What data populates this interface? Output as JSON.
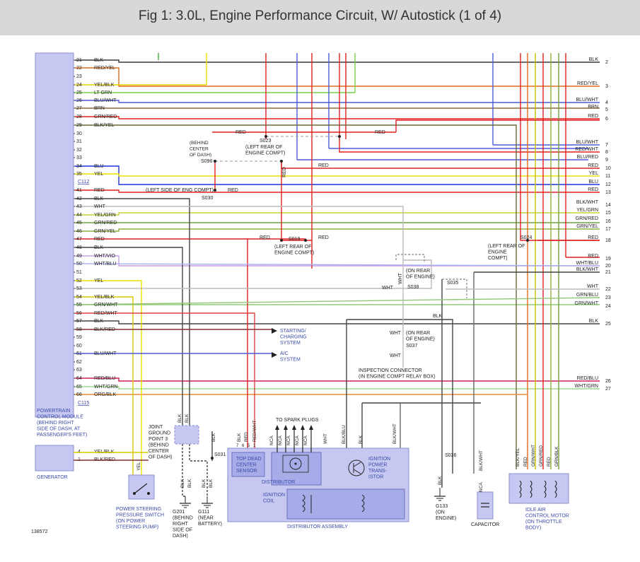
{
  "title": "Fig 1: 3.0L, Engine Performance Circuit, W/ Autostick (1 of 4)",
  "figure_number": "138572",
  "pcm": {
    "label_lines": [
      "POWERTRAIN",
      "CONTROL MODULE",
      "(BEHIND RIGHT",
      "SIDE OF DASH, AT",
      "PASSENGER'S FEET)"
    ],
    "connector_c112": "C112",
    "connector_c115": "C115"
  },
  "pins": [
    {
      "pin": "21",
      "wire": "BLK",
      "color": "#3a3a3a",
      "end": "2"
    },
    {
      "pin": "22",
      "wire": "RED/YEL",
      "color": "#e06a1a",
      "end": "3"
    },
    {
      "pin": "23",
      "wire": "",
      "color": "#e06a1a",
      "end": ""
    },
    {
      "pin": "24",
      "wire": "YEL/BLK",
      "color": "#e3d000",
      "end": ""
    },
    {
      "pin": "25",
      "wire": "LT GRN",
      "color": "#7ad14a",
      "end": ""
    },
    {
      "pin": "26",
      "wire": "BLU/WHT",
      "color": "#4c5ad8",
      "end": "4"
    },
    {
      "pin": "27",
      "wire": "BRN",
      "color": "#8b6a3e",
      "end": "5"
    },
    {
      "pin": "28",
      "wire": "GRN/RED",
      "color": "#7aa03a",
      "end": "6"
    },
    {
      "pin": "29",
      "wire": "BLK/YEL",
      "color": "#6e6a3a",
      "end": ""
    },
    {
      "pin": "30",
      "wire": "",
      "color": "#9a9a9a",
      "end": ""
    },
    {
      "pin": "31",
      "wire": "",
      "color": "#9a9a9a",
      "end": ""
    },
    {
      "pin": "32",
      "wire": "",
      "color": "#9a9a9a",
      "end": ""
    },
    {
      "pin": "33",
      "wire": "",
      "color": "#9a9a9a",
      "end": ""
    },
    {
      "pin": "34",
      "wire": "BLU",
      "color": "#2030e0",
      "end": "12"
    },
    {
      "pin": "35",
      "wire": "YEL",
      "color": "#e8e000",
      "end": "11"
    },
    {
      "pin": "41",
      "wire": "RED",
      "color": "#e02020",
      "end": "13"
    },
    {
      "pin": "42",
      "wire": "BLK",
      "color": "#444444",
      "end": ""
    },
    {
      "pin": "43",
      "wire": "WHT",
      "color": "#bbbbbb",
      "end": ""
    },
    {
      "pin": "44",
      "wire": "YEL/GRN",
      "color": "#c8d030",
      "end": "15"
    },
    {
      "pin": "45",
      "wire": "GRN/RED",
      "color": "#70a040",
      "end": "16"
    },
    {
      "pin": "46",
      "wire": "GRN/YEL",
      "color": "#90b040",
      "end": "17"
    },
    {
      "pin": "47",
      "wire": "RED",
      "color": "#e02020",
      "end": "18"
    },
    {
      "pin": "48",
      "wire": "BLK",
      "color": "#444444",
      "end": ""
    },
    {
      "pin": "49",
      "wire": "WHT/VIO",
      "color": "#c8a0e8",
      "end": "20"
    },
    {
      "pin": "50",
      "wire": "WHT/BLU",
      "color": "#a8b0f0",
      "end": ""
    },
    {
      "pin": "51",
      "wire": "",
      "color": "#9a9a9a",
      "end": ""
    },
    {
      "pin": "52",
      "wire": "YEL",
      "color": "#e8e000",
      "end": ""
    },
    {
      "pin": "53",
      "wire": "",
      "color": "#9a9a9a",
      "end": ""
    },
    {
      "pin": "54",
      "wire": "YEL/BLK",
      "color": "#d8c800",
      "end": ""
    },
    {
      "pin": "55",
      "wire": "GRN/WHT",
      "color": "#90c878",
      "end": "24"
    },
    {
      "pin": "56",
      "wire": "RED/WHT",
      "color": "#e04040",
      "end": ""
    },
    {
      "pin": "57",
      "wire": "BLK",
      "color": "#444444",
      "end": "25"
    },
    {
      "pin": "58",
      "wire": "BLK/RED",
      "color": "#883030",
      "end": ""
    },
    {
      "pin": "59",
      "wire": "",
      "color": "#9a9a9a",
      "end": ""
    },
    {
      "pin": "60",
      "wire": "",
      "color": "#9a9a9a",
      "end": ""
    },
    {
      "pin": "61",
      "wire": "BLU/WHT",
      "color": "#4c5ad8",
      "end": ""
    },
    {
      "pin": "62",
      "wire": "",
      "color": "#9a9a9a",
      "end": ""
    },
    {
      "pin": "63",
      "wire": "",
      "color": "#9a9a9a",
      "end": ""
    },
    {
      "pin": "64",
      "wire": "RED/BLU",
      "color": "#d02050",
      "end": "26"
    },
    {
      "pin": "65",
      "wire": "WHT/GRN",
      "color": "#a0d890",
      "end": "27"
    },
    {
      "pin": "66",
      "wire": "ORG/BLK",
      "color": "#e08a30",
      "end": ""
    }
  ],
  "right_labels": [
    {
      "text": "BLK",
      "num": "2"
    },
    {
      "text": "RED/YEL",
      "num": "3"
    },
    {
      "text": "BLU/WHT",
      "num": "4"
    },
    {
      "text": "BRN",
      "num": "5"
    },
    {
      "text": "RED",
      "num": "6"
    },
    {
      "text": "BLU/WHT",
      "num": "7"
    },
    {
      "text": "RED/WHT",
      "num": "8"
    },
    {
      "text": "BLU/RED",
      "num": "9"
    },
    {
      "text": "RED",
      "num": "10"
    },
    {
      "text": "YEL",
      "num": "11"
    },
    {
      "text": "BLU",
      "num": "12"
    },
    {
      "text": "RED",
      "num": "13"
    },
    {
      "text": "BLK/WHT",
      "num": "14"
    },
    {
      "text": "YEL/GRN",
      "num": "15"
    },
    {
      "text": "GRN/RED",
      "num": "16"
    },
    {
      "text": "GRN/YEL",
      "num": "17"
    },
    {
      "text": "RED",
      "num": "18"
    },
    {
      "text": "RED",
      "num": "19"
    },
    {
      "text": "WHT/BLU",
      "num": "20"
    },
    {
      "text": "BLK/WHT",
      "num": "21"
    },
    {
      "text": "WHT",
      "num": "22"
    },
    {
      "text": "GRN/BLU",
      "num": "23"
    },
    {
      "text": "GRN/WHT",
      "num": "24"
    },
    {
      "text": "BLK",
      "num": "25"
    },
    {
      "text": "RED/BLU",
      "num": "26"
    },
    {
      "text": "WHT/GRN",
      "num": "27"
    }
  ],
  "generator": {
    "label": "GENERATOR",
    "pin4": "4",
    "pin4_wire": "YEL/BLK",
    "pin1": "1",
    "pin1_wire": "BLK/RED"
  },
  "splices": {
    "s023": "S023",
    "s023_note_lines": [
      "(LEFT REAR OF",
      "ENGINE COMPT)"
    ],
    "s096": "S096",
    "s096_note_lines": [
      "(BEHIND",
      "CENTER",
      "OF DASH)"
    ],
    "s030": "S030",
    "s030_note": "(LEFT SIDE OF ENG COMPT)",
    "s019": "S019",
    "s019_note_lines": [
      "(LEFT REAR OF",
      "ENGINE COMPT)"
    ],
    "s024": "S024",
    "s024_note_lines": [
      "(LEFT REAR OF",
      "ENGINE",
      "COMPT)"
    ],
    "s038": "S038",
    "s038_note_lines": [
      "(ON REAR",
      "OF ENGINE)"
    ],
    "s035": "S035",
    "s037": "S037",
    "s037_note_lines": [
      "(ON REAR",
      "OF ENGINE)"
    ],
    "s031": "S031",
    "s036": "S036"
  },
  "wire_labels": {
    "red": "RED",
    "blk": "BLK",
    "wht": "WHT",
    "yel": "YEL",
    "red_wht": "RED/WHT",
    "blk_blu": "BLK/BLU",
    "blk_wht": "BLK/WHT",
    "nca": "NCA",
    "blk_yel": "BLK/YEL",
    "grn_wht": "GRN/WHT",
    "grn_red": "GRN/RED",
    "grn_blk": "GRN/BLK"
  },
  "destinations": {
    "starting_lines": [
      "STARTING/",
      "CHARGING",
      "SYSTEM"
    ],
    "ac_lines": [
      "A/C",
      "SYSTEM"
    ],
    "inspection_lines": [
      "INSPECTION CONNECTOR",
      "(IN ENGINE COMPT RELAY BOX)"
    ]
  },
  "components": {
    "joint_ground_lines": [
      "JOINT",
      "GROUND",
      "POINT 3",
      "(BEHIND",
      "CENTER",
      "OF DASH)"
    ],
    "ps_switch_lines": [
      "POWER STEERING",
      "PRESSURE SWITCH",
      "(ON POWER",
      "STEERING PUMP)"
    ],
    "g201_lines": [
      "G201",
      "(BEHIND",
      "RIGHT",
      "SIDE OF",
      "DASH)"
    ],
    "g111_lines": [
      "G111",
      "(NEAR",
      "BATTERY)"
    ],
    "spark_plugs": "TO SPARK PLUGS",
    "tdc_lines": [
      "TOP DEAD",
      "CENTER",
      "SENSOR"
    ],
    "distributor": "DISTRIBUTOR",
    "ign_transistor_lines": [
      "IGNITION",
      "POWER",
      "TRANS-",
      "ISTOR"
    ],
    "ign_coil_lines": [
      "IGNITION",
      "COIL"
    ],
    "distributor_assembly": "DISTRIBUTOR ASSEMBLY",
    "g133_lines": [
      "G133",
      "(ON",
      "ENGINE)"
    ],
    "capacitor": "CAPACITOR",
    "iac_lines": [
      "IDLE AIR",
      "CONTROL MOTOR",
      "(ON THROTTLE",
      "BODY)"
    ]
  },
  "colors": {
    "module_fill": "#c6c8f2",
    "module_stroke": "#8a8fd0",
    "dist_fill": "#c6c8f2",
    "label_blue": "#3a4aa8",
    "title_bg": "#d8d8d8"
  }
}
